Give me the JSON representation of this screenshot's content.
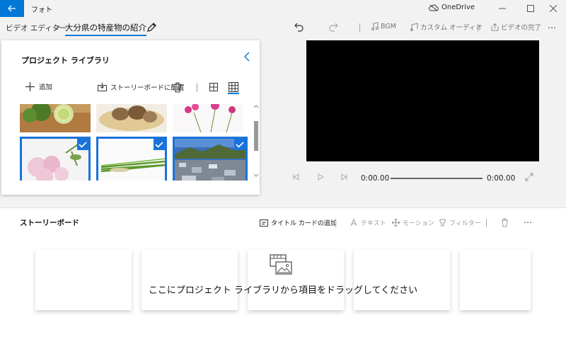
{
  "app": {
    "title": "フォト",
    "cloud_label": "OneDrive"
  },
  "breadcrumb": {
    "root": "ビデオ エディター",
    "separator": ">",
    "project": "大分県の特産物の紹介"
  },
  "toolbar": {
    "bgm_label": "BGM",
    "custom_audio_label": "カスタム オーディオ",
    "finish_label": "ビデオの完了",
    "more_label": "…"
  },
  "library": {
    "title": "プロジェクト ライブラリ",
    "add_label": "追加",
    "place_label": "ストーリーボードに配置",
    "items": [
      {
        "subject": "kabosu-citrus",
        "selected": false
      },
      {
        "subject": "shiitake-mushrooms",
        "selected": false
      },
      {
        "subject": "pink-flowers",
        "selected": false
      },
      {
        "subject": "pink-lisianthus",
        "selected": true
      },
      {
        "subject": "green-leeks",
        "selected": true
      },
      {
        "subject": "town-view",
        "selected": true
      }
    ]
  },
  "player": {
    "current_time": "0:00.00",
    "total_time": "0:00.00"
  },
  "storyboard": {
    "title": "ストーリーボード",
    "add_title_card_label": "タイトル カードの追加",
    "text_label": "テキスト",
    "motion_label": "モーション",
    "filter_label": "フィルター",
    "more_label": "…",
    "empty_message": "ここにプロジェクト ライブラリから項目をドラッグしてください"
  },
  "colors": {
    "accent": "#0078d7",
    "selection": "#1a73d9",
    "preview_bg": "#000000"
  }
}
